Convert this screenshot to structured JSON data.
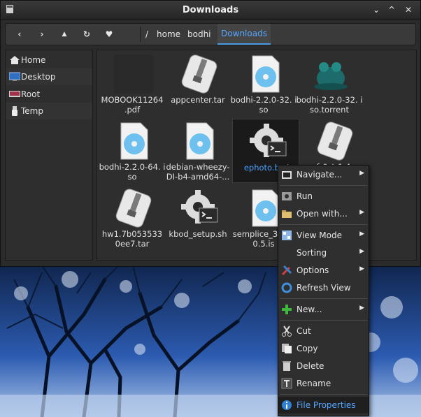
{
  "window": {
    "title": "Downloads",
    "controls": {
      "close": "✕",
      "maximize": "^",
      "minimize": "⌄"
    }
  },
  "toolbar": {
    "back": "‹",
    "forward": "›",
    "up": "▲",
    "refresh": "↻",
    "favorite": "♥",
    "path_root": "/",
    "crumbs": [
      "home",
      "bodhi",
      "Downloads"
    ]
  },
  "sidebar": {
    "items": [
      {
        "label": "Home",
        "icon": "home-icon"
      },
      {
        "label": "Desktop",
        "icon": "desktop-icon"
      },
      {
        "label": "Root",
        "icon": "drive-icon"
      },
      {
        "label": "Temp",
        "icon": "usb-icon"
      }
    ]
  },
  "files": [
    {
      "name": "MOBOOK11264 .pdf",
      "type": "pdf"
    },
    {
      "name": "appcenter.tar",
      "type": "archive"
    },
    {
      "name": "bodhi-2.2.0-32. iso",
      "type": "disc"
    },
    {
      "name": "bodhi-2.2.0-32. iso.torrent",
      "type": "torrent"
    },
    {
      "name": "bodhi-2.2.0-64. iso",
      "type": "disc"
    },
    {
      "name": "debian-wheezy-DI-b4-amd64-...",
      "type": "disc"
    },
    {
      "name": "ephoto.bsd",
      "type": "script",
      "selected": true
    },
    {
      "name": "fr0st-1.4",
      "type": "archive"
    },
    {
      "name": "hw1.7b053533 0ee7.tar",
      "type": "archive"
    },
    {
      "name": "kbod_setup.sh",
      "type": "script"
    },
    {
      "name": "semplice_3 _300.5.is",
      "type": "disc"
    }
  ],
  "context_menu": {
    "items": [
      {
        "label": "Navigate...",
        "icon": "navigate-icon",
        "submenu": true
      },
      {
        "label": "Run",
        "icon": "run-icon",
        "submenu": false
      },
      {
        "label": "Open with...",
        "icon": "open-with-icon",
        "submenu": true
      },
      {
        "label": "View Mode",
        "icon": "view-mode-icon",
        "submenu": true
      },
      {
        "label": "Sorting",
        "icon": "",
        "submenu": true
      },
      {
        "label": "Options",
        "icon": "options-icon",
        "submenu": true
      },
      {
        "label": "Refresh View",
        "icon": "refresh-icon",
        "submenu": false
      },
      {
        "label": "New...",
        "icon": "new-icon",
        "submenu": true
      },
      {
        "label": "Cut",
        "icon": "cut-icon",
        "submenu": false
      },
      {
        "label": "Copy",
        "icon": "copy-icon",
        "submenu": false
      },
      {
        "label": "Delete",
        "icon": "delete-icon",
        "submenu": false
      },
      {
        "label": "Rename",
        "icon": "rename-icon",
        "submenu": false
      },
      {
        "label": "File Properties",
        "icon": "info-icon",
        "submenu": false,
        "highlighted": true
      }
    ]
  },
  "colors": {
    "accent": "#57a8ff",
    "window_bg": "#2b2b2b",
    "panel_bg": "#2e2e2e"
  }
}
